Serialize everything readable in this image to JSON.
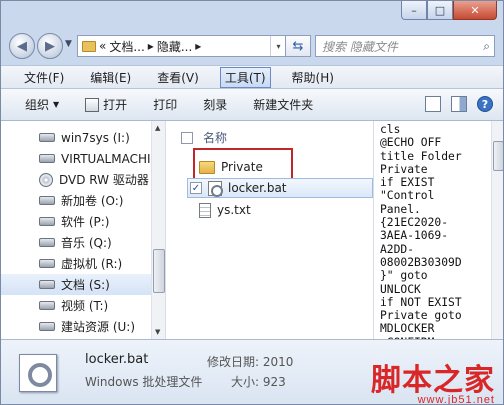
{
  "window": {
    "caption_min": "–",
    "caption_max": "□",
    "caption_close": "✕"
  },
  "address_bar": {
    "prefix": "«",
    "segment1": "文档...",
    "separator1": "▸",
    "segment2": "隐藏...",
    "separator2": "▸",
    "dropdown": "▾",
    "refresh_symbol": "⇆"
  },
  "search": {
    "placeholder": "搜索 隐藏文件"
  },
  "menu": {
    "items": [
      "文件(F)",
      "编辑(E)",
      "查看(V)",
      "工具(T)",
      "帮助(H)"
    ],
    "highlighted": "工具(T)"
  },
  "toolbar": {
    "organize": "组织",
    "open": "打开",
    "print": "打印",
    "burn": "刻录",
    "new_folder": "新建文件夹"
  },
  "navigation": {
    "items": [
      {
        "label": "win7sys (I:)",
        "icon": "drive-icon"
      },
      {
        "label": "VIRTUALMACHI",
        "icon": "drive-icon"
      },
      {
        "label": "DVD RW 驱动器",
        "icon": "disc-icon"
      },
      {
        "label": "新加卷 (O:)",
        "icon": "drive-icon"
      },
      {
        "label": "软件 (P:)",
        "icon": "drive-icon"
      },
      {
        "label": "音乐 (Q:)",
        "icon": "drive-icon"
      },
      {
        "label": "虚拟机 (R:)",
        "icon": "drive-icon"
      },
      {
        "label": "文档 (S:)",
        "icon": "drive-icon",
        "selected": true
      },
      {
        "label": "视频 (T:)",
        "icon": "drive-icon"
      },
      {
        "label": "建站资源 (U:)",
        "icon": "drive-icon"
      }
    ]
  },
  "file_list": {
    "column_name": "名称",
    "files": [
      {
        "name": "Private",
        "type": "folder"
      },
      {
        "name": "locker.bat",
        "type": "bat",
        "checked": true
      },
      {
        "name": "ys.txt",
        "type": "txt"
      }
    ]
  },
  "preview": {
    "lines": [
      "cls",
      "@ECHO OFF",
      "title Folder",
      "Private",
      "if EXIST",
      "\"Control",
      "Panel.",
      "{21EC2020-",
      "3AEA-1069-",
      "A2DD-",
      "08002B30309D",
      "}\" goto",
      "UNLOCK",
      "if NOT EXIST",
      "Private goto",
      "MDLOCKER",
      ":CONFIRM"
    ]
  },
  "details": {
    "file_name": "locker.bat",
    "file_type": "Windows 批处理文件",
    "modified_label": "修改日期: 2010",
    "size_label": "大小: 923"
  },
  "watermark": {
    "main": "脚本之家",
    "url": "www.jb51.net"
  }
}
